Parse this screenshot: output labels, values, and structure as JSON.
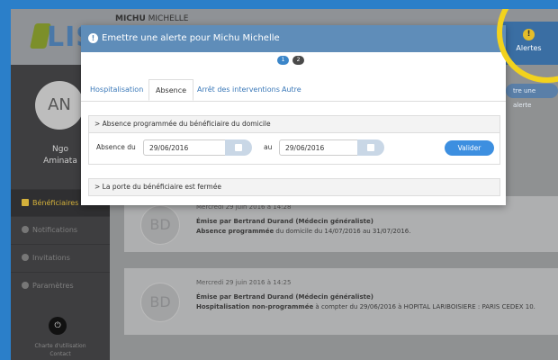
{
  "header": {
    "user_first": "MICHU",
    "user_last": "MICHELLE",
    "logo_text": "LISA",
    "alertes_label": "Alertes",
    "alertes_icon": "!"
  },
  "sidebar": {
    "avatar_initials": "AN",
    "name_first": "Ngo",
    "name_last": "Aminata",
    "items": [
      {
        "label": "Bénéficiaires",
        "active": true
      },
      {
        "label": "Notifications"
      },
      {
        "label": "Invitations"
      },
      {
        "label": "Paramètres"
      }
    ],
    "power_icon": "⏻",
    "footer_line1": "Charte d'utilisation",
    "footer_line2": "Contact"
  },
  "main": {
    "new_alert_label": "tre une alerte",
    "cards": [
      {
        "initials": "BD",
        "date": "Mercredi 29 juin 2016 à 14:28",
        "author": "Émise par Bertrand Durand (Médecin généraliste)",
        "desc_bold": "Absence programmée",
        "desc_rest": " du domicile du 14/07/2016 au 31/07/2016."
      },
      {
        "initials": "BD",
        "date": "Mercredi 29 juin 2016 à 14:25",
        "author": "Émise par Bertrand Durand (Médecin généraliste)",
        "desc_bold": "Hospitalisation non-programmée",
        "desc_rest": " à compter du 29/06/2016 à HOPITAL LARIBOISIERE : PARIS CEDEX 10."
      }
    ]
  },
  "modal": {
    "title": "Emettre une alerte pour Michu Michelle",
    "steps": [
      "1",
      "2"
    ],
    "tabs": [
      "Hospitalisation",
      "Absence",
      "Arrêt des interventions",
      "Autre"
    ],
    "section1_title": "> Absence programmée du bénéficiaire du domicile",
    "absence_du_label": "Absence du",
    "date_from": "29/06/2016",
    "au_label": "au",
    "date_to": "29/06/2016",
    "valider_label": "Valider",
    "section2_title": "> La porte du bénéficiaire est fermée"
  },
  "colors": {
    "modal_header": "#5f8db9",
    "accent": "#3d8fe0",
    "highlight_ring": "#f2d21d"
  }
}
